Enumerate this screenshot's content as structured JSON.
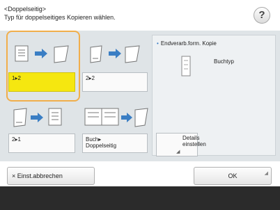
{
  "header": {
    "title": "<Doppelseitig>",
    "subtitle": "Typ für doppelseitiges Kopieren wählen.",
    "help_label": "?"
  },
  "options": [
    {
      "label": "1▸2",
      "selected": true
    },
    {
      "label": "2▸2",
      "selected": false
    },
    {
      "label": "2▸1",
      "selected": false
    },
    {
      "label_line1": "Buch▸",
      "label_line2": "Doppelseitig",
      "selected": false
    }
  ],
  "right_panel": {
    "title": "Endverarb.form. Kopie",
    "value": "Buchtyp",
    "details_line1": "Details",
    "details_line2": "einstellen"
  },
  "buttons": {
    "cancel": "Einst.abbrechen",
    "ok": "OK"
  },
  "colors": {
    "selected": "#f5e710",
    "focus_ring": "#f1ae4b",
    "arrow": "#3a7ec4"
  }
}
